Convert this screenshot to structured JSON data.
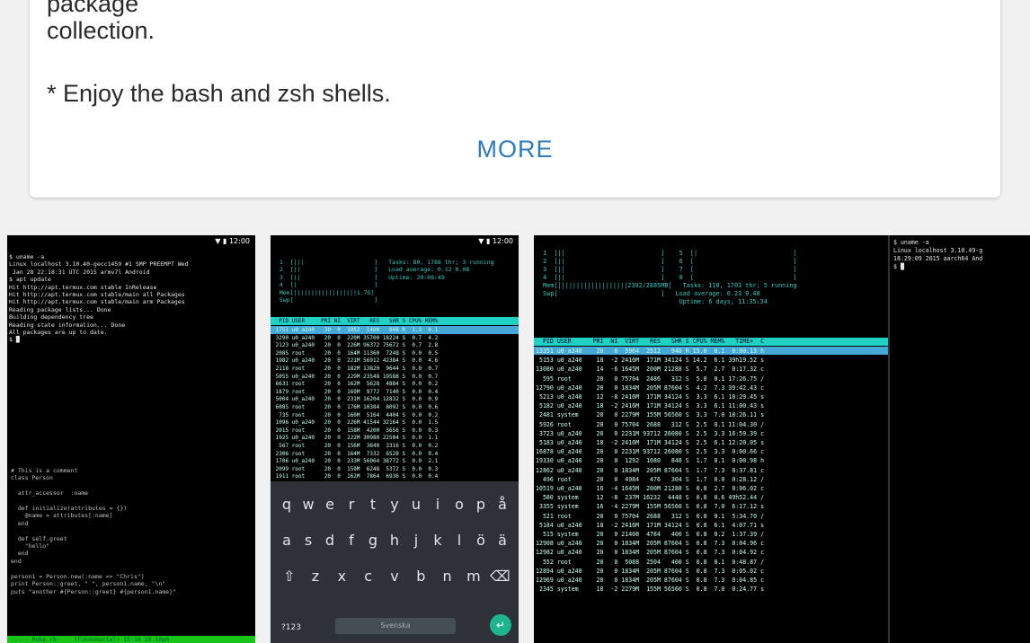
{
  "description": {
    "lines": [
      "package",
      "collection.",
      "* Enjoy the bash and zsh shells."
    ],
    "more_label": "MORE"
  },
  "status_time": "12:00",
  "screenshots": [
    {
      "terminal_top": [
        "$ uname -a",
        "Linux localhost 3.10.40-gecc1459 #1 SMP PREEMPT Wed",
        " Jan 28 22:18:31 UTC 2015 armv7l Android",
        "$ apt update",
        "Hit http://apt.termux.com stable InRelease",
        "Hit http://apt.termux.com stable/main all Packages",
        "Hit http://apt.termux.com stable/main arm Packages",
        "Reading package lists... Done",
        "Building dependency tree",
        "Reading state information... Done",
        "All packages are up to date.",
        "$ █"
      ],
      "code_lines": [
        "# This is a comment",
        "class Person",
        "",
        "  attr_accessor  :name",
        "",
        "  def initialize(attributes = {})",
        "    @name = attributes[:name]",
        "  end",
        "",
        "  def self.greet",
        "    \"hello\"",
        "  end",
        "end",
        "",
        "person1 = Person.new(:name => \"Chris\")",
        "print Person::greet, \" \", person1.name, \"\\n\"",
        "puts \"another #{Person::greet} #{person1.name}\""
      ],
      "bottom_status": "-:--- Ruby.rb     (Fundamental) 15:18 20.10pm"
    },
    {
      "htop_header": [
        "  1  [|||                    ]   Tasks: 80, 1788 thr; 3 running",
        "  2  [||                     ]   Load average: 0.12 0.08",
        "  3  [||                     ]   Uptime: 20:08:49",
        "  4  [|                      ]",
        "  Mem[||||||||||||||||||1.7G]",
        "  Swp[                       ]"
      ],
      "process_header": "  PID USER     PRI NI  VIRT   RES   SHR S CPU% MEM%",
      "process_rows": [
        " 1751 u0_a240   20  0  1952  1400   848 R  1.3  0.1",
        " 3290 u0_a240   20  0  220M 35700 18224 S  0.7  4.2",
        " 2123 u0_a240   20  0  226M 96372 75672 S  0.7  2.8",
        " 2085 root      20  0  164M 11360  7248 S  0.0  0.5",
        " 1982 u0_a240   20  0  221M 56912 42384 S  0.0  4.6",
        " 2118 root      20  0  182M 13820  9644 S  0.0  0.7",
        " 5055 u0_a240   20  0  229M 23548 19588 S  0.0  0.7",
        " 6631 root      20  0  162M  5628  4884 S  0.0  0.2",
        " 1879 root      20  0  169M  9772  7140 S  0.0  0.4",
        " 5004 u0_a240   20  0  231M 16204 12832 S  0.0  0.9",
        " 6085 root      20  0  176M 10384  8092 S  0.0  0.6",
        "  735 root      20  0  160M  5164  4404 S  0.0  0.2",
        " 1096 u0_a240   20  0  226M 41544 32164 S  0.0  1.5",
        " 2015 root      20  0  158M  4200  3656 S  0.0  0.3",
        " 1925 u0_a240   20  0  222M 30980 22504 S  0.0  1.1",
        "  567 root      20  0  156M  3840  3316 S  0.0  0.2",
        " 2306 root      20  0  164M  7332  6528 S  0.0  0.4",
        " 1706 u0_a240   20  0  233M 56064 38772 S  0.0  2.1",
        " 2099 root      20  0  159M  6248  5372 S  0.0  0.3",
        " 1911 root      20  0  162M  7864  6936 S  0.0  0.4"
      ],
      "keyboard": {
        "row1": [
          "q",
          "w",
          "e",
          "r",
          "t",
          "y",
          "u",
          "i",
          "o",
          "p",
          "å"
        ],
        "row2": [
          "a",
          "s",
          "d",
          "f",
          "g",
          "h",
          "j",
          "k",
          "l",
          "ö",
          "ä"
        ],
        "row3": [
          "⇧",
          "z",
          "x",
          "c",
          "v",
          "b",
          "n",
          "m",
          "⌫"
        ],
        "mode_key": "?123",
        "space_label": "Svenska",
        "enter_key": "↵"
      }
    },
    {
      "htop_header": [
        "  1  [||                          ]    5  [|                          ]",
        "  2  [||                          ]    6  [                           ]",
        "  3  [||                          ]    7  [                           ]",
        "  4  [||                          ]    8  [                           ]",
        "  Mem[|||||||||||||||||||2392/2885MB]   Tasks: 110, 1703 thr; 5 running",
        "  Swp[                            ]   Load average: 0.23 0.48",
        "                                       Uptime: 6 days, 11:35:34"
      ],
      "process_header": "  PID USER      PRI  NI  VIRT   RES   SHR S CPU% MEM%   TIME+  C",
      "process_rows": [
        "13351 u0_a240    20   0  5964  2512   940 R 15.0  0.1  0:00.13 h",
        " 5153 u0_a240    18  -2 2416M  171M 34124 S 14.2  6.1 39h19.52 s",
        "13080 u0_a240    14  -6 1645M  200M 21288 S  5.7  2.7  0:17.32 c",
        "  595 root       20   0 75704  2486   312 S  5.0  0.1 17:26.75 /",
        "12790 u0_a240    20   0 1834M  205M 87604 S  4.2  7.3 39:42.43 c",
        " 5213 u0_a240    12  -8 2416M  171M 34124 S  3.3  6.1 10:29.45 s",
        " 5182 u0_a240    18  -2 2416M  171M 34124 S  3.3  6.1 11:00.43 s",
        " 2481 system     20   0 2279M  155M 56560 S  3.3  7.0 18:26.11 s",
        " 5926 root       20   0 75704  2688   312 S  2.5  0.1 11:04.30 /",
        " 3723 u0_a240    20   0 2231M 93712 26080 S  2.5  3.3 16:59.39 c",
        " 5183 u0_a240    18  -2 2416M  171M 34124 S  2.5  6.1 12:20.05 s",
        "16878 u0_a240    20   0 2231M 93712 26080 S  2.5  3.3  0:00.66 c",
        "19330 u0_a240    20   0  1292  1680   848 S  1.7  0.1  0:00.98 h",
        "12862 u0_a240    20   0 1834M  205M 87604 S  1.7  7.3  0:37.81 c",
        "  496 root       20   0  4984   476   304 S  1.7  0.0  0:28.12 /",
        "10519 u0_a240    16  -4 1645M  200M 21288 S  0.8  2.7  0:06.02 c",
        "  580 system     12  -8  237M 16232  4448 S  0.8  0.6 49h52.44 /",
        " 3355 system     16  -4 2279M  155M 56560 S  0.8  7.0  6:17.12 s",
        "  521 root       20   0 75704  2688   312 S  0.8  0.1  5:34.70 /",
        " 5184 u0_a240    18  -2 2416M  171M 34124 S  0.8  6.1  4:07.71 s",
        "  515 system     20   0 21408  4784   400 S  0.8  0.2  1:37.39 /",
        "12908 u0_a240    20   0 1834M  205M 87604 S  0.8  7.3  0:04.96 c",
        "12982 u0_a240    20   0 1834M  205M 87604 S  0.8  7.3  0:04.92 c",
        "  552 root       20   0  5088  2504   400 S  0.8  0.1  0:48.87 /",
        "12894 u0_a240    20   0 1834M  205M 87604 S  0.8  7.3  0:05.02 c",
        "12969 u0_a240    20   0 1834M  205M 87604 S  0.8  7.3  0:04.85 c",
        " 2345 system     18  -2 2279M  155M 56560 S  0.8  7.0  0:24.77 s"
      ],
      "side_terminal": [
        "$ uname -a",
        "Linux localhost 3.10.49-g",
        "18:29:09 2015 aarch64 And",
        "$ █"
      ]
    }
  ]
}
